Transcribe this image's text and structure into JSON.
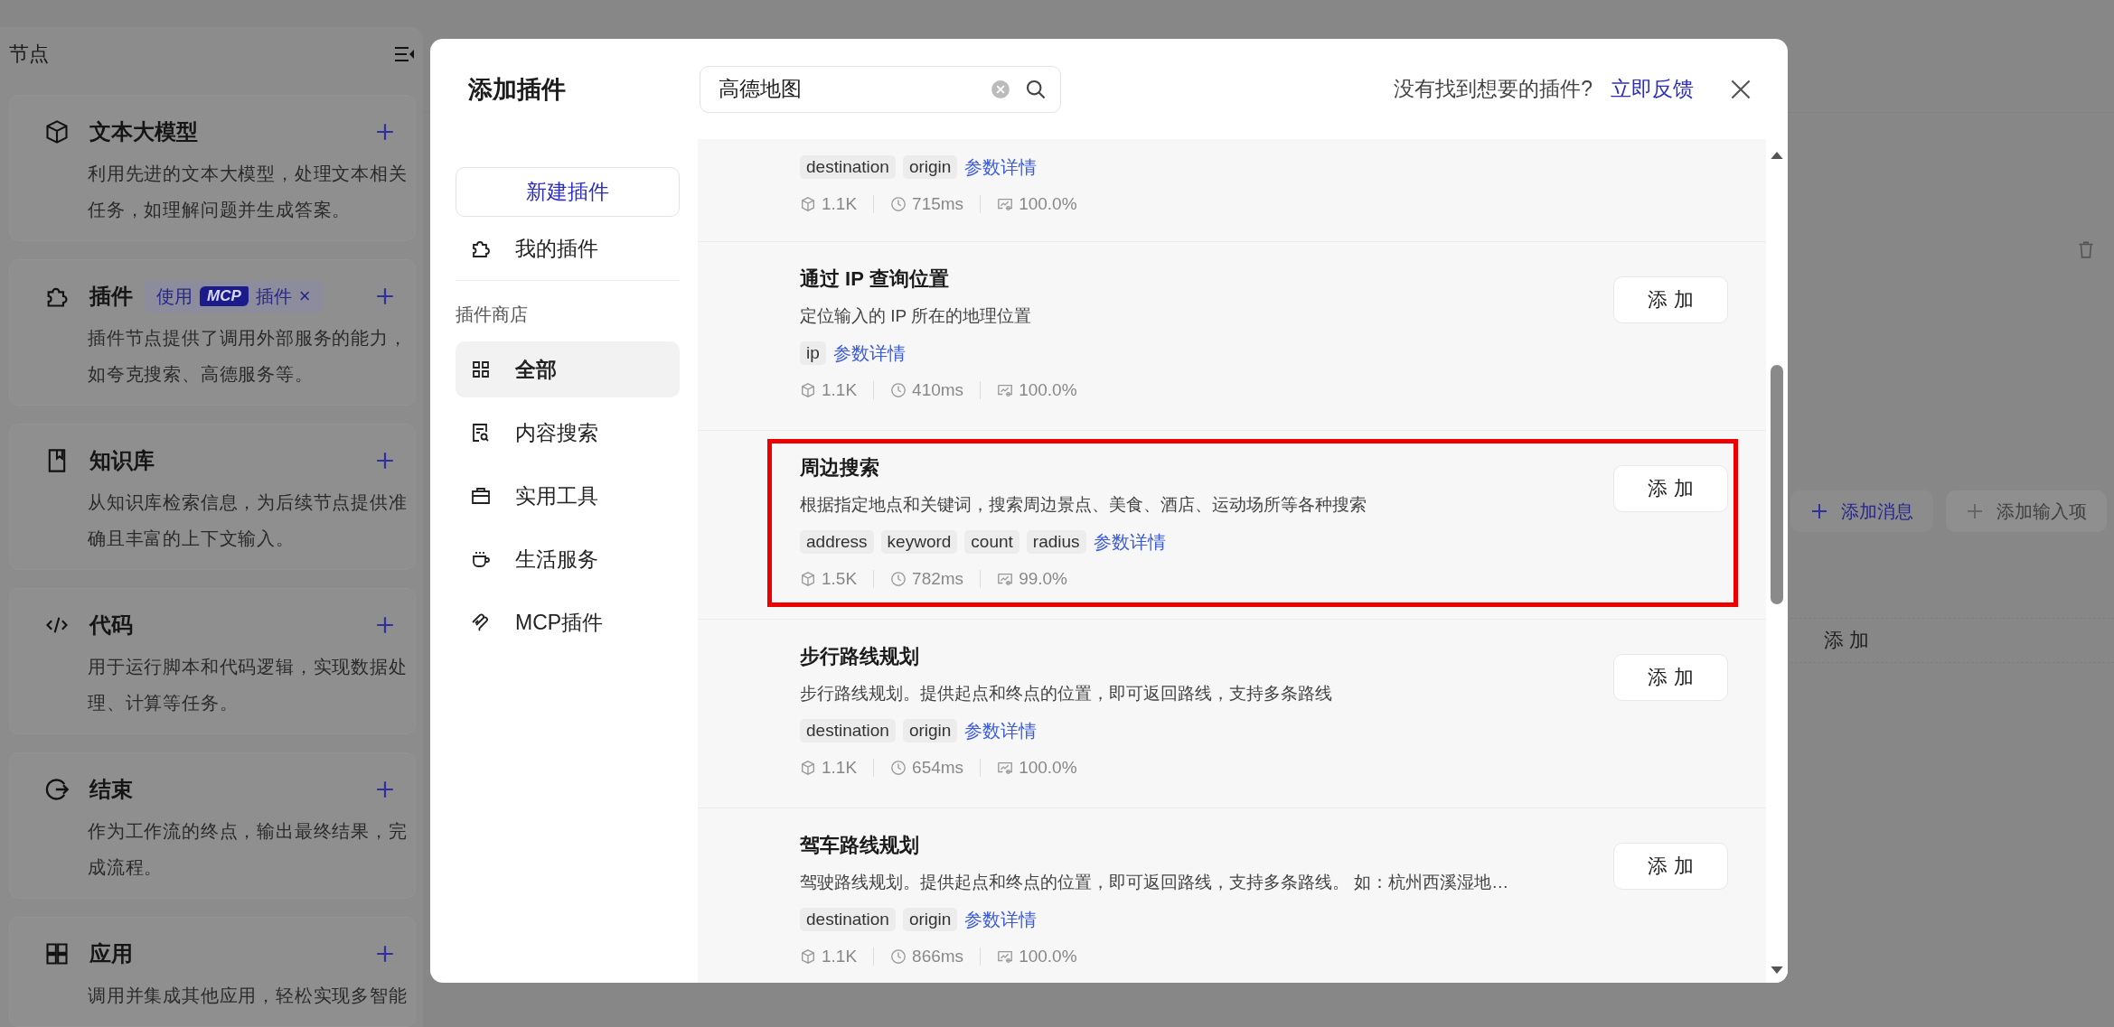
{
  "node_panel": {
    "title": "节点",
    "nodes": [
      {
        "kind": "model",
        "title": "文本大模型",
        "description": "利用先进的文本大模型，处理文本相关任务，如理解问题并生成答案。"
      },
      {
        "kind": "plugin",
        "title": "插件",
        "tag": {
          "prefix": "使用",
          "badge": "MCP",
          "suffix": "插件",
          "close": "×"
        },
        "description": "插件节点提供了调用外部服务的能力，如夸克搜索、高德服务等。"
      },
      {
        "kind": "knowledge",
        "title": "知识库",
        "description": "从知识库检索信息，为后续节点提供准确且丰富的上下文输入。"
      },
      {
        "kind": "code",
        "title": "代码",
        "description": "用于运行脚本和代码逻辑，实现数据处理、计算等任务。"
      },
      {
        "kind": "end",
        "title": "结束",
        "description": "作为工作流的终点，输出最终结果，完成流程。"
      },
      {
        "kind": "app",
        "title": "应用",
        "description": "调用并集成其他应用，轻松实现多智能"
      }
    ]
  },
  "background_panel": {
    "buttons": [
      {
        "label": "添加消息",
        "disabled": false
      },
      {
        "label": "添加输入项",
        "disabled": true
      }
    ],
    "row_label": "添 加"
  },
  "modal": {
    "title": "添加插件",
    "search": {
      "value": "高德地图"
    },
    "feedback_prompt": "没有找到想要的插件?",
    "feedback_link": "立即反馈",
    "sidebar": {
      "new_button": "新建插件",
      "my_plugins": "我的插件",
      "store_heading": "插件商店",
      "categories": [
        {
          "kind": "all",
          "label": "全部",
          "selected": true
        },
        {
          "kind": "search",
          "label": "内容搜索",
          "selected": false
        },
        {
          "kind": "tools",
          "label": "实用工具",
          "selected": false
        },
        {
          "kind": "life",
          "label": "生活服务",
          "selected": false
        },
        {
          "kind": "mcp",
          "label": "MCP插件",
          "selected": false
        }
      ]
    },
    "plugins": [
      {
        "params": [
          "destination",
          "origin"
        ],
        "details_link": "参数详情",
        "stats": {
          "uses": "1.1K",
          "latency": "715ms",
          "success": "100.0%"
        },
        "highlighted": false
      },
      {
        "title": "通过 IP 查询位置",
        "description": "定位输入的 IP 所在的地理位置",
        "params": [
          "ip"
        ],
        "details_link": "参数详情",
        "stats": {
          "uses": "1.1K",
          "latency": "410ms",
          "success": "100.0%"
        },
        "add_button": "添 加",
        "highlighted": false
      },
      {
        "title": "周边搜索",
        "description": "根据指定地点和关键词，搜索周边景点、美食、酒店、运动场所等各种搜索",
        "params": [
          "address",
          "keyword",
          "count",
          "radius"
        ],
        "details_link": "参数详情",
        "stats": {
          "uses": "1.5K",
          "latency": "782ms",
          "success": "99.0%"
        },
        "add_button": "添 加",
        "highlighted": true
      },
      {
        "title": "步行路线规划",
        "description": "步行路线规划。提供起点和终点的位置，即可返回路线，支持多条路线",
        "params": [
          "destination",
          "origin"
        ],
        "details_link": "参数详情",
        "stats": {
          "uses": "1.1K",
          "latency": "654ms",
          "success": "100.0%"
        },
        "add_button": "添 加",
        "highlighted": false
      },
      {
        "title": "驾车路线规划",
        "description": "驾驶路线规划。提供起点和终点的位置，即可返回路线，支持多条路线。 如：杭州西溪湿地…",
        "params": [
          "destination",
          "origin"
        ],
        "details_link": "参数详情",
        "stats": {
          "uses": "1.1K",
          "latency": "866ms",
          "success": "100.0%"
        },
        "add_button": "添 加",
        "highlighted": false
      }
    ]
  }
}
